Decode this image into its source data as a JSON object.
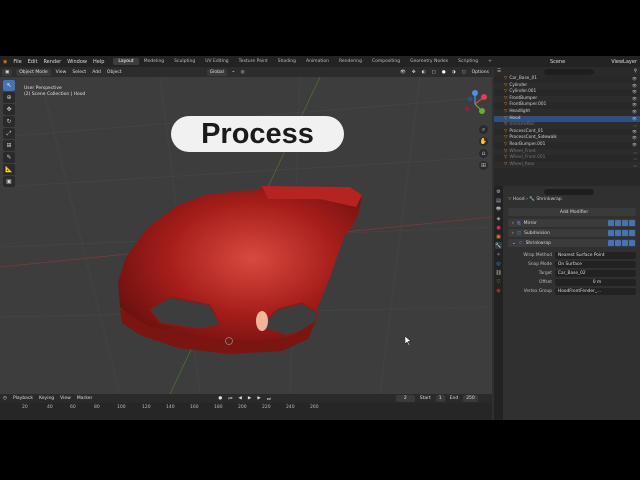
{
  "menubar": {
    "menus": [
      "File",
      "Edit",
      "Render",
      "Window",
      "Help"
    ],
    "workspaces": [
      "Layout",
      "Modeling",
      "Sculpting",
      "UV Editing",
      "Texture Paint",
      "Shading",
      "Animation",
      "Rendering",
      "Compositing",
      "Geometry Nodes",
      "Scripting"
    ],
    "active_workspace": "Layout",
    "scene": "Scene",
    "view_layer": "ViewLayer"
  },
  "viewport_header": {
    "mode": "Object Mode",
    "menus": [
      "View",
      "Select",
      "Add",
      "Object"
    ],
    "transform": "Global",
    "options": "Options"
  },
  "viewport": {
    "perspective": "User Perspective",
    "collection": "(2) Scene Collection | Hood",
    "overlay_title": "Process"
  },
  "timeline": {
    "menus": [
      "Playback",
      "Keying",
      "View",
      "Marker"
    ],
    "current_frame": "2",
    "start_label": "Start",
    "start": "1",
    "end_label": "End",
    "end": "250",
    "ticks": [
      "20",
      "40",
      "60",
      "80",
      "100",
      "120",
      "140",
      "160",
      "180",
      "200",
      "220",
      "240",
      "260"
    ]
  },
  "outliner": {
    "items": [
      {
        "name": "Car_Base_01",
        "hidden": false
      },
      {
        "name": "Cylinder",
        "hidden": false
      },
      {
        "name": "Cylinder.001",
        "hidden": false
      },
      {
        "name": "FrontBumper",
        "hidden": false
      },
      {
        "name": "FrontBumper.001",
        "hidden": false
      },
      {
        "name": "Headlight",
        "hidden": false
      },
      {
        "name": "Hood",
        "hidden": false
      },
      {
        "name": "mirrorreflec",
        "hidden": true
      },
      {
        "name": "ProcessCont_01",
        "hidden": false
      },
      {
        "name": "ProcessCont_Sidewalk",
        "hidden": false
      },
      {
        "name": "RearBumper.001",
        "hidden": false
      },
      {
        "name": "Wheel_Front",
        "hidden": true
      },
      {
        "name": "Wheel_Front.001",
        "hidden": true
      },
      {
        "name": "Wheel_Rear",
        "hidden": true
      }
    ],
    "search_placeholder": ""
  },
  "properties": {
    "object": "Hood",
    "modifier_context": "Shrinkwrap",
    "add_modifier": "Add Modifier",
    "modifiers": [
      "Mirror",
      "Subdivision",
      "Shrinkwrap"
    ],
    "fields": [
      {
        "label": "Wrap Method",
        "value": "Nearest Surface Point"
      },
      {
        "label": "Snap Mode",
        "value": "On Surface"
      },
      {
        "label": "Target",
        "value": "Car_Base_02"
      },
      {
        "label": "Offset",
        "value": "0 m"
      },
      {
        "label": "Vertex Group",
        "value": "HoodFrontFender_..."
      }
    ]
  },
  "colors": {
    "accent": "#4772b3",
    "car_paint": "#b0201c",
    "badge_bg": "#f1f1f1"
  }
}
